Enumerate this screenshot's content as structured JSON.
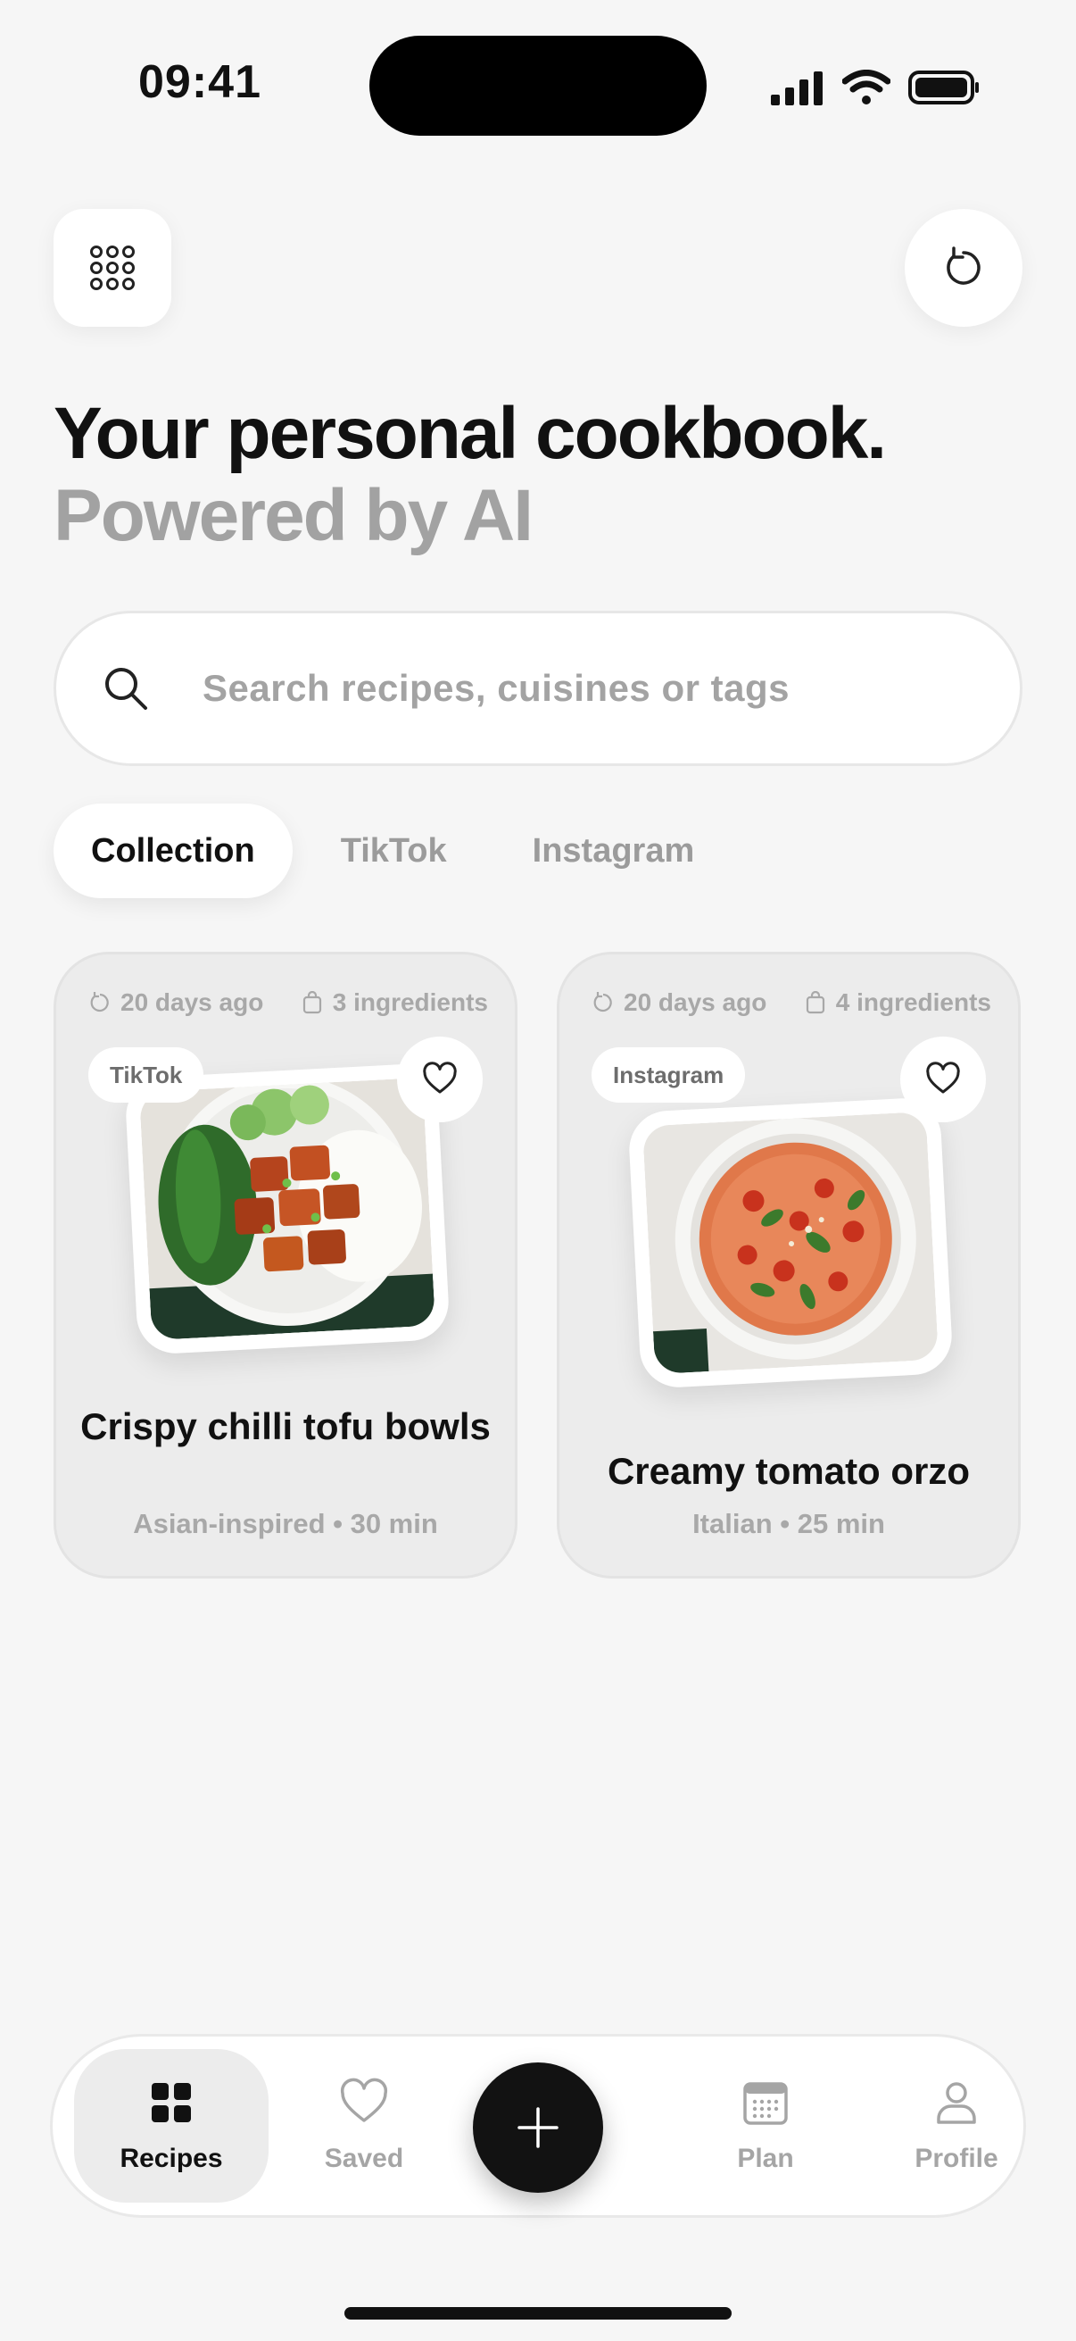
{
  "status_bar": {
    "time": "09:41",
    "icons": [
      "signal-icon",
      "wifi-icon",
      "battery-icon"
    ]
  },
  "header": {
    "menu_icon": "grid-icon",
    "refresh_icon": "refresh-icon"
  },
  "headline": {
    "line1": "Your personal cookbook.",
    "line2": "Powered by AI"
  },
  "search": {
    "placeholder": "Search recipes, cuisines or tags",
    "icon": "search-icon"
  },
  "tabs": [
    {
      "label": "Collection",
      "active": true
    },
    {
      "label": "TikTok",
      "active": false
    },
    {
      "label": "Instagram",
      "active": false
    }
  ],
  "recipes": [
    {
      "time_ago": "20 days ago",
      "ingredients": "3 ingredients",
      "source": "TikTok",
      "title": "Crispy chilli tofu bowls",
      "subtitle": "Asian-inspired • 30 min",
      "favorite_icon": "heart-outline-icon"
    },
    {
      "time_ago": "20 days ago",
      "ingredients": "4 ingredients",
      "source": "Instagram",
      "title": "Creamy tomato orzo",
      "subtitle": "Italian • 25 min",
      "favorite_icon": "heart-outline-icon"
    }
  ],
  "bottom_nav": {
    "items": [
      {
        "label": "Recipes",
        "icon": "grid-icon",
        "active": true
      },
      {
        "label": "Saved",
        "icon": "heart-icon",
        "active": false
      },
      {
        "label": "Plan",
        "icon": "calendar-icon",
        "active": false
      },
      {
        "label": "Profile",
        "icon": "person-icon",
        "active": false
      }
    ],
    "fab_icon": "plus-icon"
  },
  "colors": {
    "background": "#f6f6f6",
    "card": "#ececec",
    "accent": "#121212",
    "muted_text": "#a2a2a2"
  }
}
